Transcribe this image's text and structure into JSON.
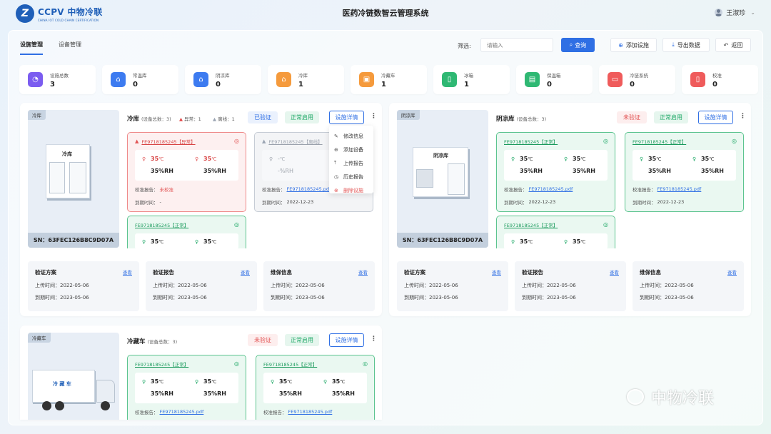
{
  "header": {
    "logo_mark": "Z",
    "logo_name": "CCPV 中物冷联",
    "logo_sub": "CHINA IOT COLD CHAIN CERTIFICATION",
    "title": "医药冷链数智云管理系统",
    "user": "王淑珍"
  },
  "tabs": [
    "设施管理",
    "设备管理"
  ],
  "toolbar": {
    "filter_label": "筛选:",
    "search_placeholder": "请输入",
    "query": "查询",
    "add": "添加设施",
    "export": "导出数据",
    "back": "返回"
  },
  "stats": [
    {
      "label": "设施总数",
      "value": "3",
      "color": "#7b5cf0",
      "icon": "pie-icon",
      "glyph": "◔"
    },
    {
      "label": "常温库",
      "value": "0",
      "color": "#3d7bf0",
      "icon": "house-icon",
      "glyph": "⌂"
    },
    {
      "label": "阴凉库",
      "value": "0",
      "color": "#3d7bf0",
      "icon": "house-icon",
      "glyph": "⌂"
    },
    {
      "label": "冷库",
      "value": "1",
      "color": "#f59a3c",
      "icon": "house-icon",
      "glyph": "⌂"
    },
    {
      "label": "冷藏车",
      "value": "1",
      "color": "#f59a3c",
      "icon": "truck-icon",
      "glyph": "▣"
    },
    {
      "label": "冰箱",
      "value": "1",
      "color": "#2fb873",
      "icon": "fridge-icon",
      "glyph": "▯"
    },
    {
      "label": "保温箱",
      "value": "0",
      "color": "#2fb873",
      "icon": "box-icon",
      "glyph": "▤"
    },
    {
      "label": "冷链系统",
      "value": "0",
      "color": "#ef5b5b",
      "icon": "monitor-icon",
      "glyph": "▭"
    },
    {
      "label": "校准",
      "value": "0",
      "color": "#ef5b5b",
      "icon": "gauge-icon",
      "glyph": "▯"
    }
  ],
  "cold": {
    "tag": "冷库",
    "sn": "SN：63FEC126B8C9D07A",
    "name": "冷库",
    "count": "(设备总数：3)",
    "abnormal": "异常：1",
    "offline": "离线：1",
    "status": "已验证",
    "enabled": "正常启用",
    "detail": "设施详情",
    "box_label": "冷库",
    "cards": [
      {
        "title": "FE9718185245【异常】",
        "t1": "35",
        "t2": "35",
        "h1": "35%RH",
        "h2": "35%RH",
        "report_label": "校准报告：",
        "report": "未校准",
        "due_label": "到期时间：",
        "due": "-"
      },
      {
        "title": "FE9718185245【离线】",
        "t1": "-",
        "h1": "-%RH",
        "report_label": "校准报告：",
        "report": "FE9718185245.pdf",
        "due_label": "到期时间：",
        "due": "2022-12-23"
      },
      {
        "title": "FE9718185245【正常】",
        "t1": "35",
        "t2": "35"
      }
    ]
  },
  "menu": [
    "修改信息",
    "添加设备",
    "上传报告",
    "历史报告",
    "删除设施"
  ],
  "shade": {
    "tag": "阴凉库",
    "sn": "SN：63FEC126B8C9D07A",
    "name": "阴凉库",
    "count": "(设备总数：3)",
    "status": "未验证",
    "enabled": "正常启用",
    "detail": "设施详情",
    "box_label": "阴凉库",
    "cards": [
      {
        "title": "FE9718185245【正常】",
        "t1": "35",
        "t2": "35",
        "h1": "35%RH",
        "h2": "35%RH",
        "report_label": "校准报告：",
        "report": "FE9718185245.pdf",
        "due_label": "到期时间：",
        "due": "2022-12-23"
      },
      {
        "title": "FE9718185245【正常】",
        "t1": "35",
        "t2": "35",
        "h1": "35%RH",
        "h2": "35%RH",
        "report_label": "校准报告：",
        "report": "FE9718185245.pdf",
        "due_label": "到期时间：",
        "due": "2022-12-23"
      },
      {
        "title": "FE9718185245【正常】",
        "t1": "35",
        "t2": "35"
      }
    ]
  },
  "truck": {
    "tag": "冷藏车",
    "name": "冷藏车",
    "count": "(设备总数：3)",
    "status": "未验证",
    "enabled": "正常启用",
    "detail": "设施详情",
    "truck_label": "冷 藏 车",
    "cards": [
      {
        "title": "FE9718185245【正常】",
        "t1": "35",
        "t2": "35",
        "h1": "35%RH",
        "h2": "35%RH",
        "report_label": "校准报告：",
        "report": "FE9718185245.pdf"
      },
      {
        "title": "FE9718185245【正常】",
        "t1": "35",
        "t2": "35",
        "h1": "35%RH",
        "h2": "35%RH",
        "report_label": "校准报告：",
        "report": "FE9718185245.pdf"
      }
    ]
  },
  "info": {
    "a": "验证方案",
    "b": "验证报告",
    "c": "维保信息",
    "view": "查看",
    "up": "上传时间：",
    "due": "到期时间：",
    "up_date": "2022-05-06",
    "due_date": "2023-05-06"
  },
  "unit": "℃",
  "watermark": "中物冷联"
}
